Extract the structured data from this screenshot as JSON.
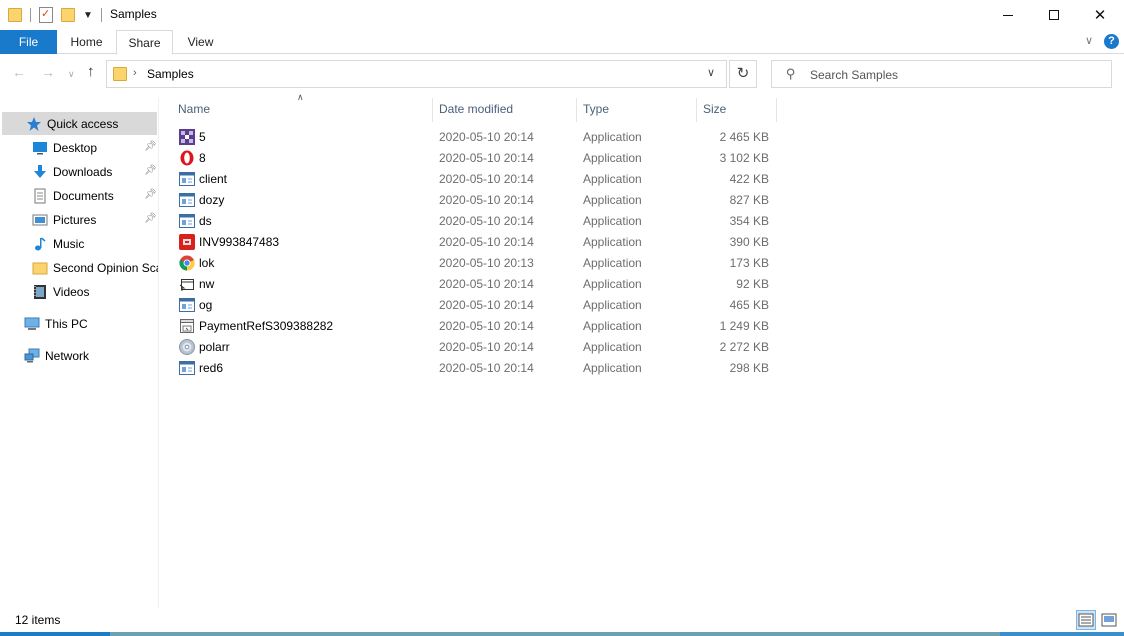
{
  "window": {
    "title": "Samples",
    "controls": [
      "minimize",
      "maximize",
      "close"
    ]
  },
  "ribbon": {
    "tabs": [
      {
        "label": "File"
      },
      {
        "label": "Home"
      },
      {
        "label": "Share"
      },
      {
        "label": "View"
      }
    ],
    "active_tab": "Share"
  },
  "address_bar": {
    "path": "Samples"
  },
  "search": {
    "placeholder": "Search Samples"
  },
  "nav_pane": {
    "items": [
      {
        "label": "Quick access",
        "icon": "star-icon",
        "selected": true
      },
      {
        "label": "Desktop",
        "icon": "desktop-icon",
        "pinned": true
      },
      {
        "label": "Downloads",
        "icon": "download-icon",
        "pinned": true
      },
      {
        "label": "Documents",
        "icon": "documents-icon",
        "pinned": true
      },
      {
        "label": "Pictures",
        "icon": "pictures-icon",
        "pinned": true
      },
      {
        "label": "Music",
        "icon": "music-icon"
      },
      {
        "label": "Second Opinion Scanner",
        "icon": "folder-icon"
      },
      {
        "label": "Videos",
        "icon": "videos-icon"
      },
      {
        "label": "This PC",
        "icon": "computer-icon"
      },
      {
        "label": "Network",
        "icon": "network-icon"
      }
    ]
  },
  "file_list": {
    "columns": [
      "Name",
      "Date modified",
      "Type",
      "Size"
    ],
    "sort_column": "Name",
    "rows": [
      {
        "name": "5",
        "date": "2020-05-10 20:14",
        "type": "Application",
        "size": "2 465 KB",
        "icon": "purple-app-icon"
      },
      {
        "name": "8",
        "date": "2020-05-10 20:14",
        "type": "Application",
        "size": "3 102 KB",
        "icon": "opera-icon"
      },
      {
        "name": "client",
        "date": "2020-05-10 20:14",
        "type": "Application",
        "size": "422 KB",
        "icon": "generic-app-icon"
      },
      {
        "name": "dozy",
        "date": "2020-05-10 20:14",
        "type": "Application",
        "size": "827 KB",
        "icon": "generic-app-icon"
      },
      {
        "name": "ds",
        "date": "2020-05-10 20:14",
        "type": "Application",
        "size": "354 KB",
        "icon": "generic-app-icon"
      },
      {
        "name": "INV993847483",
        "date": "2020-05-10 20:14",
        "type": "Application",
        "size": "390 KB",
        "icon": "red-app-icon"
      },
      {
        "name": "lok",
        "date": "2020-05-10 20:13",
        "type": "Application",
        "size": "173 KB",
        "icon": "chrome-icon"
      },
      {
        "name": "nw",
        "date": "2020-05-10 20:14",
        "type": "Application",
        "size": "92 KB",
        "icon": "window-app-icon"
      },
      {
        "name": "og",
        "date": "2020-05-10 20:14",
        "type": "Application",
        "size": "465 KB",
        "icon": "generic-app-icon"
      },
      {
        "name": "PaymentRefS309388282",
        "date": "2020-05-10 20:14",
        "type": "Application",
        "size": "1 249 KB",
        "icon": "document-app-icon"
      },
      {
        "name": "polarr",
        "date": "2020-05-10 20:14",
        "type": "Application",
        "size": "2 272 KB",
        "icon": "disc-icon"
      },
      {
        "name": "red6",
        "date": "2020-05-10 20:14",
        "type": "Application",
        "size": "298 KB",
        "icon": "generic-app-icon"
      }
    ]
  },
  "status_bar": {
    "item_count": "12 items"
  },
  "colors": {
    "accent": "#1979ca",
    "selected_nav": "#d9d9d9",
    "header_text": "#4c607a",
    "secondary_text": "#6d6d6d"
  }
}
